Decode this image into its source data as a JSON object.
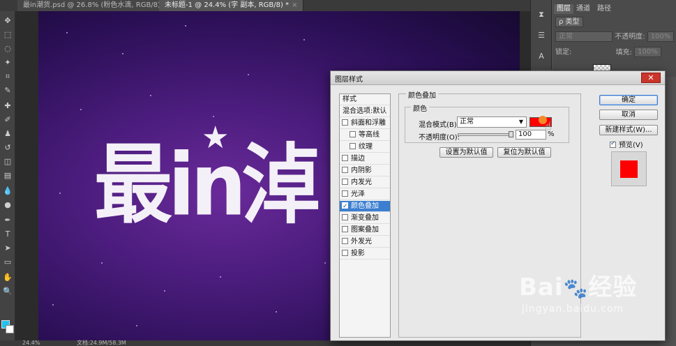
{
  "tabs": [
    {
      "label": "最in潮货.psd @ 26.8% (粉色水滴, RGB/8) *"
    },
    {
      "label": "未标题-1 @ 24.4% (字 副本, RGB/8) *"
    }
  ],
  "status": {
    "zoom": "24.4%",
    "doc": "文档:24.9M/58.3M"
  },
  "canvas": {
    "art_text": "最in淖"
  },
  "panel": {
    "tabs": [
      "图层",
      "通道",
      "路径"
    ],
    "kind_label": "ρ 类型",
    "blend_value": "正常",
    "opacity_label": "不透明度:",
    "opacity_value": "100%",
    "lock_label": "锁定:",
    "fill_label": "填充:",
    "fill_value": "100%"
  },
  "dialog": {
    "title": "图层样式",
    "close": "✕",
    "styles_header": "样式",
    "blend_options": "混合选项:默认",
    "items": [
      {
        "label": "斜面和浮雕",
        "checked": false
      },
      {
        "label": "等高线",
        "checked": false,
        "sub": true
      },
      {
        "label": "纹理",
        "checked": false,
        "sub": true
      },
      {
        "label": "描边",
        "checked": false
      },
      {
        "label": "内阴影",
        "checked": false
      },
      {
        "label": "内发光",
        "checked": false
      },
      {
        "label": "光泽",
        "checked": false
      },
      {
        "label": "颜色叠加",
        "checked": true,
        "selected": true
      },
      {
        "label": "渐变叠加",
        "checked": false
      },
      {
        "label": "图案叠加",
        "checked": false
      },
      {
        "label": "外发光",
        "checked": false
      },
      {
        "label": "投影",
        "checked": false
      }
    ],
    "section_title": "颜色叠加",
    "color_group": "颜色",
    "blend_mode_label": "混合模式(B):",
    "blend_mode_value": "正常",
    "overlay_color": "#ff0000",
    "opacity_label": "不透明度(O):",
    "opacity_value": "100",
    "opacity_unit": "%",
    "set_default": "设置为默认值",
    "reset_default": "复位为默认值",
    "ok": "确定",
    "cancel": "取消",
    "new_style": "新建样式(W)...",
    "preview_label": "预览(V)",
    "preview_checked": true
  },
  "watermark": {
    "logo": "Bai💩经验",
    "sub": "jingyan.baidu.com"
  }
}
